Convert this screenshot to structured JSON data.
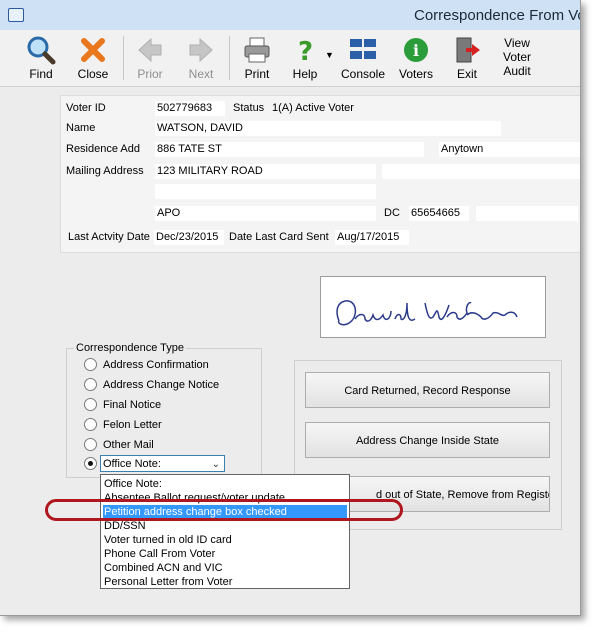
{
  "window": {
    "title": "Correspondence From Vo"
  },
  "toolbar": [
    {
      "label": "Find",
      "icon": "magnifier-icon",
      "enabled": true
    },
    {
      "label": "Close",
      "icon": "close-x-icon",
      "enabled": true
    },
    {
      "label": "Prior",
      "icon": "arrow-left-icon",
      "enabled": false
    },
    {
      "label": "Next",
      "icon": "arrow-right-icon",
      "enabled": false
    },
    {
      "label": "Print",
      "icon": "printer-icon",
      "enabled": true
    },
    {
      "label": "Help",
      "icon": "help-icon",
      "enabled": true
    },
    {
      "label": "Console",
      "icon": "console-icon",
      "enabled": true
    },
    {
      "label": "Voters",
      "icon": "info-icon",
      "enabled": true
    },
    {
      "label": "Exit",
      "icon": "exit-door-icon",
      "enabled": true
    },
    {
      "label": "View Voter Audit",
      "label_lines": [
        "View",
        "Voter",
        "Audit"
      ],
      "enabled": true
    }
  ],
  "voter": {
    "voter_id_label": "Voter ID",
    "voter_id": "502779683",
    "status_label": "Status",
    "status": "1(A) Active Voter",
    "name_label": "Name",
    "name": "WATSON, DAVID",
    "residence_label": "Residence Add",
    "residence_address": "886 TATE ST",
    "residence_city": "Anytown",
    "mailing_label": "Mailing Address",
    "mailing_line1": "123 MILITARY ROAD",
    "mailing_line2": "",
    "mailing_city": "APO",
    "mailing_state": "DC",
    "mailing_zip": "65654665",
    "last_activity_label": "Last Actvity Date",
    "last_activity_date": "Dec/23/2015",
    "last_card_label": "Date Last Card Sent",
    "last_card_date": "Aug/17/2015"
  },
  "signature": {
    "text": "David Watson"
  },
  "correspondence": {
    "group_label": "Correspondence Type",
    "options": [
      {
        "label": "Address Confirmation",
        "selected": false
      },
      {
        "label": "Address Change Notice",
        "selected": false
      },
      {
        "label": "Final Notice",
        "selected": false
      },
      {
        "label": "Felon Letter",
        "selected": false
      },
      {
        "label": "Other Mail",
        "selected": false
      }
    ],
    "office_note_selected": true,
    "combo_value": "Office Note:"
  },
  "dropdown": {
    "items": [
      "Office Note:",
      "Absentee Ballot request/voter update",
      "Petition address change box checked",
      "DD/SSN",
      "Voter turned in old ID card",
      "Phone Call From Voter",
      "Combined ACN and VIC",
      "Personal Letter from Voter"
    ],
    "highlighted_index": 2
  },
  "actions": {
    "card_returned": "Card Returned, Record Response",
    "address_change_inside": "Address Change Inside State",
    "moved_out": "d out of State, Remove from Register"
  },
  "colors": {
    "highlight": "#3399ff",
    "annotation": "#b0161e"
  }
}
